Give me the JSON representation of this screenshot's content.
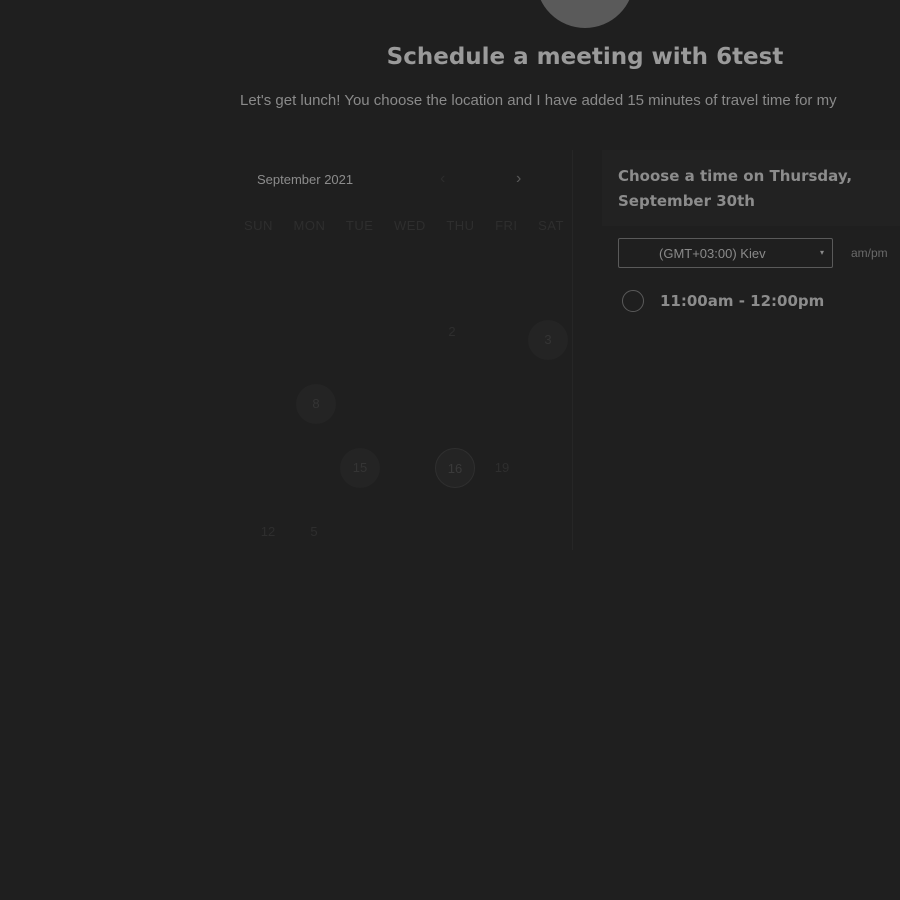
{
  "header": {
    "title": "Schedule a meeting with 6test",
    "description": "Let's get lunch! You choose the location and I have added 15 minutes of travel time for my"
  },
  "calendar": {
    "month_label": "September 2021",
    "prev_icon": "‹",
    "next_icon": "›",
    "weekdays": [
      "SUN",
      "MON",
      "TUE",
      "WED",
      "THU",
      "FRI",
      "SAT"
    ],
    "days": {
      "d2": "2",
      "d3": "3",
      "d8": "8",
      "d15": "15",
      "d16": "16",
      "d19": "19",
      "d12": "12",
      "d26": "5"
    }
  },
  "panel": {
    "choose_title": "Choose a time on Thursday, September 30th",
    "timezone": "(GMT+03:00) Kiev",
    "timezone_caret": "▾",
    "ampm_label": "am/pm",
    "slots": [
      "11:00am - 12:00pm"
    ]
  },
  "colors": {
    "background": "#1f1f1f",
    "title": "#9a9a9a",
    "muted": "#8a8a8a"
  }
}
